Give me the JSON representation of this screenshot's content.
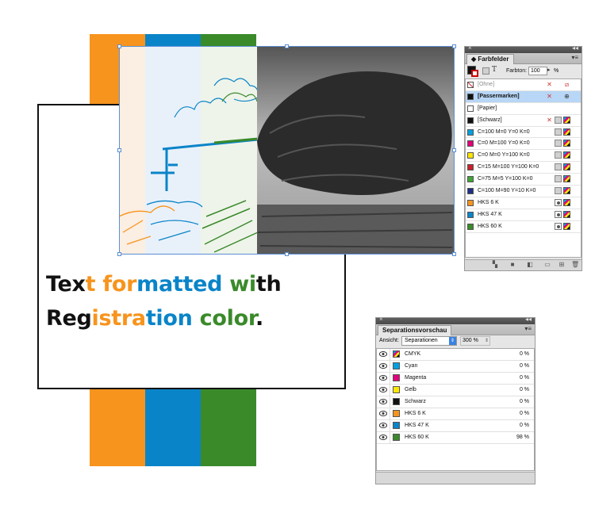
{
  "document": {
    "headline_line1": [
      "Tex",
      "t ",
      "for",
      "mat",
      "ted ",
      "wi",
      "th"
    ],
    "headline_line2": [
      "Reg",
      "istra",
      "tion ",
      "color",
      "."
    ],
    "colors": {
      "orange": "#F7941D",
      "blue": "#0A84C8",
      "green": "#3A8A2A",
      "black": "#111111"
    }
  },
  "swatches_panel": {
    "title": "Farbfelder",
    "tint_label": "Farbton:",
    "tint_value": "100",
    "tint_unit": "%",
    "items": [
      {
        "label": "[Ohne]",
        "color": "none",
        "selected": false,
        "dimmed": true
      },
      {
        "label": "[Passermarken]",
        "color": "#111111",
        "selected": true,
        "dimmed": false
      },
      {
        "label": "[Papier]",
        "color": "#ffffff",
        "selected": false,
        "dimmed": false
      },
      {
        "label": "[Schwarz]",
        "color": "#111111",
        "selected": false,
        "dimmed": false
      },
      {
        "label": "C=100 M=0 Y=0 K=0",
        "color": "#00A0E0",
        "selected": false,
        "dimmed": false
      },
      {
        "label": "C=0 M=100 Y=0 K=0",
        "color": "#E2007A",
        "selected": false,
        "dimmed": false
      },
      {
        "label": "C=0 M=0 Y=100 K=0",
        "color": "#FFE600",
        "selected": false,
        "dimmed": false
      },
      {
        "label": "C=15 M=100 Y=100 K=0",
        "color": "#C8202A",
        "selected": false,
        "dimmed": false
      },
      {
        "label": "C=75 M=5 Y=100 K=0",
        "color": "#3FA535",
        "selected": false,
        "dimmed": false
      },
      {
        "label": "C=100 M=90 Y=10 K=0",
        "color": "#1E2F84",
        "selected": false,
        "dimmed": false
      },
      {
        "label": "HKS 6 K",
        "color": "#F7941D",
        "selected": false,
        "dimmed": false
      },
      {
        "label": "HKS 47 K",
        "color": "#0A84C8",
        "selected": false,
        "dimmed": false
      },
      {
        "label": "HKS 60 K",
        "color": "#3A8A2A",
        "selected": false,
        "dimmed": false
      }
    ]
  },
  "separations_panel": {
    "title": "Separationsvorschau",
    "view_label": "Ansicht:",
    "view_value": "Separationen",
    "zoom_value": "300 %",
    "items": [
      {
        "label": "CMYK",
        "value": "0 %",
        "color": "cmyk"
      },
      {
        "label": "Cyan",
        "value": "0 %",
        "color": "#00A0E0"
      },
      {
        "label": "Magenta",
        "value": "0 %",
        "color": "#E2007A"
      },
      {
        "label": "Gelb",
        "value": "0 %",
        "color": "#FFE600"
      },
      {
        "label": "Schwarz",
        "value": "0 %",
        "color": "#111111"
      },
      {
        "label": "HKS 6 K",
        "value": "0 %",
        "color": "#F7941D"
      },
      {
        "label": "HKS 47 K",
        "value": "0 %",
        "color": "#0A84C8"
      },
      {
        "label": "HKS 60 K",
        "value": "98 %",
        "color": "#3A8A2A"
      }
    ]
  }
}
